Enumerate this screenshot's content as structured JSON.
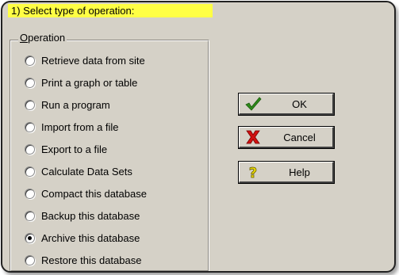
{
  "step_title": "1) Select type of operation:",
  "group": {
    "label_accel": "O",
    "label_rest": "peration"
  },
  "options": [
    {
      "label": "Retrieve data from site",
      "checked": false
    },
    {
      "label": "Print a graph or table",
      "checked": false
    },
    {
      "label": "Run a program",
      "checked": false
    },
    {
      "label": "Import from a file",
      "checked": false
    },
    {
      "label": "Export to a file",
      "checked": false
    },
    {
      "label": "Calculate Data Sets",
      "checked": false
    },
    {
      "label": "Compact this database",
      "checked": false
    },
    {
      "label": "Backup this database",
      "checked": false
    },
    {
      "label": "Archive this database",
      "checked": true
    },
    {
      "label": "Restore this database",
      "checked": false
    }
  ],
  "buttons": {
    "ok": {
      "label": "OK",
      "icon": "checkmark-icon",
      "color": "#2e8b1a"
    },
    "cancel": {
      "label": "Cancel",
      "icon": "red-x-icon",
      "color": "#d01010"
    },
    "help": {
      "label": "Help",
      "icon": "question-mark-icon",
      "color": "#e8d800"
    }
  }
}
